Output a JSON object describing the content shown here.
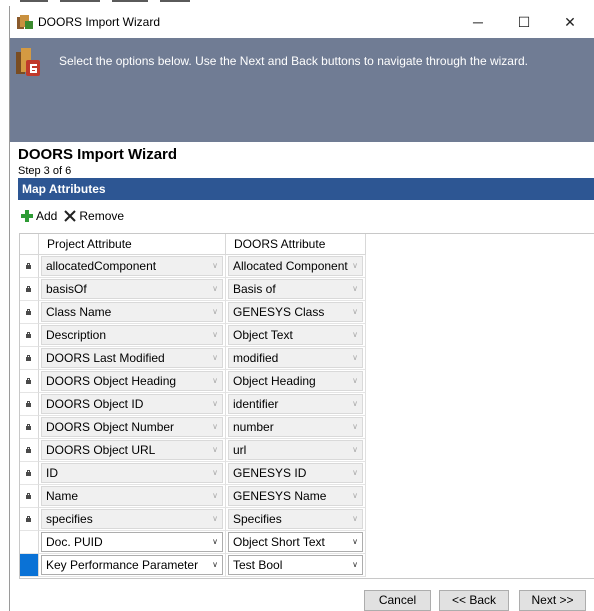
{
  "window": {
    "title": "DOORS Import Wizard",
    "controls": {
      "minimize": "─",
      "maximize": "☐",
      "close": "✕"
    }
  },
  "banner": {
    "text": "Select the options below. Use the Next and Back buttons to navigate through the wizard.",
    "color": "#707c94"
  },
  "wizard": {
    "title": "DOORS Import Wizard",
    "step": "Step 3 of 6",
    "section": "Map Attributes"
  },
  "toolbar": {
    "add_label": "Add",
    "remove_label": "Remove"
  },
  "grid": {
    "columns": [
      "Project Attribute",
      "DOORS Attribute"
    ],
    "rows": [
      {
        "project": "allocatedComponent",
        "doors": "Allocated Component",
        "locked": true
      },
      {
        "project": "basisOf",
        "doors": "Basis of",
        "locked": true
      },
      {
        "project": "Class Name",
        "doors": "GENESYS Class",
        "locked": true
      },
      {
        "project": "Description",
        "doors": "Object Text",
        "locked": true
      },
      {
        "project": "DOORS Last Modified",
        "doors": "modified",
        "locked": true
      },
      {
        "project": "DOORS Object Heading",
        "doors": "Object Heading",
        "locked": true
      },
      {
        "project": "DOORS Object ID",
        "doors": "identifier",
        "locked": true
      },
      {
        "project": "DOORS Object Number",
        "doors": "number",
        "locked": true
      },
      {
        "project": "DOORS Object URL",
        "doors": "url",
        "locked": true
      },
      {
        "project": "ID",
        "doors": "GENESYS ID",
        "locked": true
      },
      {
        "project": "Name",
        "doors": "GENESYS Name",
        "locked": true
      },
      {
        "project": "specifies",
        "doors": "Specifies",
        "locked": true
      },
      {
        "project": "Doc. PUID",
        "doors": "Object Short Text",
        "locked": false
      },
      {
        "project": "Key Performance Parameter",
        "doors": "Test Bool",
        "locked": false,
        "selected": true
      }
    ]
  },
  "buttons": {
    "cancel": "Cancel",
    "back": "<< Back",
    "next": "Next >>"
  },
  "colors": {
    "section_bar": "#2d5693",
    "selection": "#0a72d6",
    "add_green": "#2e9b35"
  }
}
